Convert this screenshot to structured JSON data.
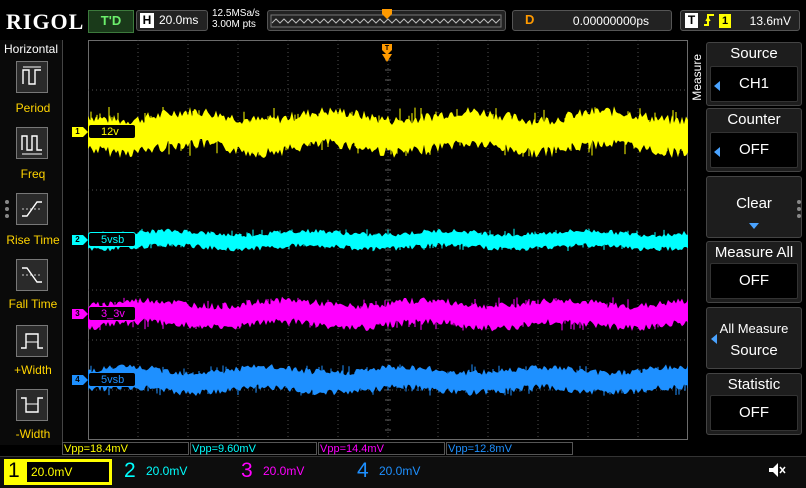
{
  "header": {
    "logo": "RIGOL",
    "run_status": "T'D",
    "timebase_key": "H",
    "timebase": "20.0ms",
    "sample_rate": "12.5MSa/s",
    "memory_depth": "3.00M pts",
    "horizontal_position_key": "D",
    "horizontal_position": "0.00000000ps",
    "trigger_key": "T",
    "trigger_source": "1",
    "trigger_level": "13.6mV"
  },
  "left_menu": {
    "title": "Horizontal",
    "items": [
      {
        "label": "Period",
        "icon": "period-icon"
      },
      {
        "label": "Freq",
        "icon": "frequency-icon"
      },
      {
        "label": "Rise Time",
        "icon": "rise-time-icon"
      },
      {
        "label": "Fall Time",
        "icon": "fall-time-icon"
      },
      {
        "label": "+Width",
        "icon": "positive-width-icon"
      },
      {
        "label": "-Width",
        "icon": "negative-width-icon"
      }
    ]
  },
  "right_menu": {
    "title": "Measure",
    "items": [
      {
        "label": "Source",
        "value": "CH1"
      },
      {
        "label": "Counter",
        "value": "OFF"
      },
      {
        "label": "Clear",
        "value": ""
      },
      {
        "label": "Measure All",
        "value": "OFF"
      },
      {
        "label": "All Measure",
        "value": "Source"
      },
      {
        "label": "Statistic",
        "value": "OFF"
      }
    ]
  },
  "channels": [
    {
      "id": "1",
      "label": "12v",
      "scale": "20.0mV",
      "color": "#ffff00",
      "level": 0.23,
      "amp": 0.045,
      "measure": "Vpp=18.4mV"
    },
    {
      "id": "2",
      "label": "5vsb",
      "scale": "20.0mV",
      "color": "#00ffff",
      "level": 0.5,
      "amp": 0.02,
      "measure": "Vpp=9.60mV"
    },
    {
      "id": "3",
      "label": "3_3v",
      "scale": "20.0mV",
      "color": "#ff00ff",
      "level": 0.685,
      "amp": 0.03,
      "measure": "Vpp=14.4mV"
    },
    {
      "id": "4",
      "label": "5vsb",
      "scale": "20.0mV",
      "color": "#1e90ff",
      "level": 0.85,
      "amp": 0.028,
      "measure": "Vpp=12.8mV"
    }
  ],
  "colors": {
    "ch1": "#ffff00",
    "ch2": "#00ffff",
    "ch3": "#ff00ff",
    "ch4": "#1e90ff",
    "trigger_marker": "#ff9a00",
    "menu_accent": "#4aa3ff"
  }
}
